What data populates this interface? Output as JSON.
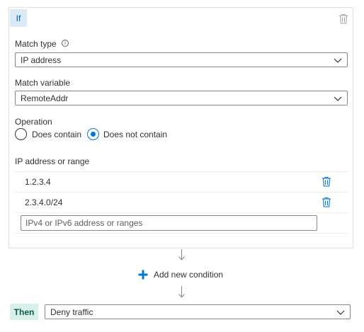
{
  "if_block": {
    "badge": "If",
    "match_type": {
      "label": "Match type",
      "value": "IP address"
    },
    "match_variable": {
      "label": "Match variable",
      "value": "RemoteAddr"
    },
    "operation": {
      "label": "Operation",
      "options": [
        "Does contain",
        "Does not contain"
      ],
      "selected": "Does not contain"
    },
    "ip_list": {
      "label": "IP address or range",
      "entries": [
        "1.2.3.4",
        "2.3.4.0/24"
      ],
      "placeholder": "IPv4 or IPv6 address or ranges"
    }
  },
  "add_condition": {
    "label": "Add new condition"
  },
  "then_block": {
    "badge": "Then",
    "action": "Deny traffic"
  },
  "colors": {
    "accent": "#0078d4",
    "if_badge_bg": "#dbeaf7",
    "then_badge_bg": "#d7f1ea"
  },
  "icons": [
    "delete-icon",
    "info-icon",
    "chevron-down-icon",
    "plus-icon",
    "arrow-down-icon"
  ]
}
